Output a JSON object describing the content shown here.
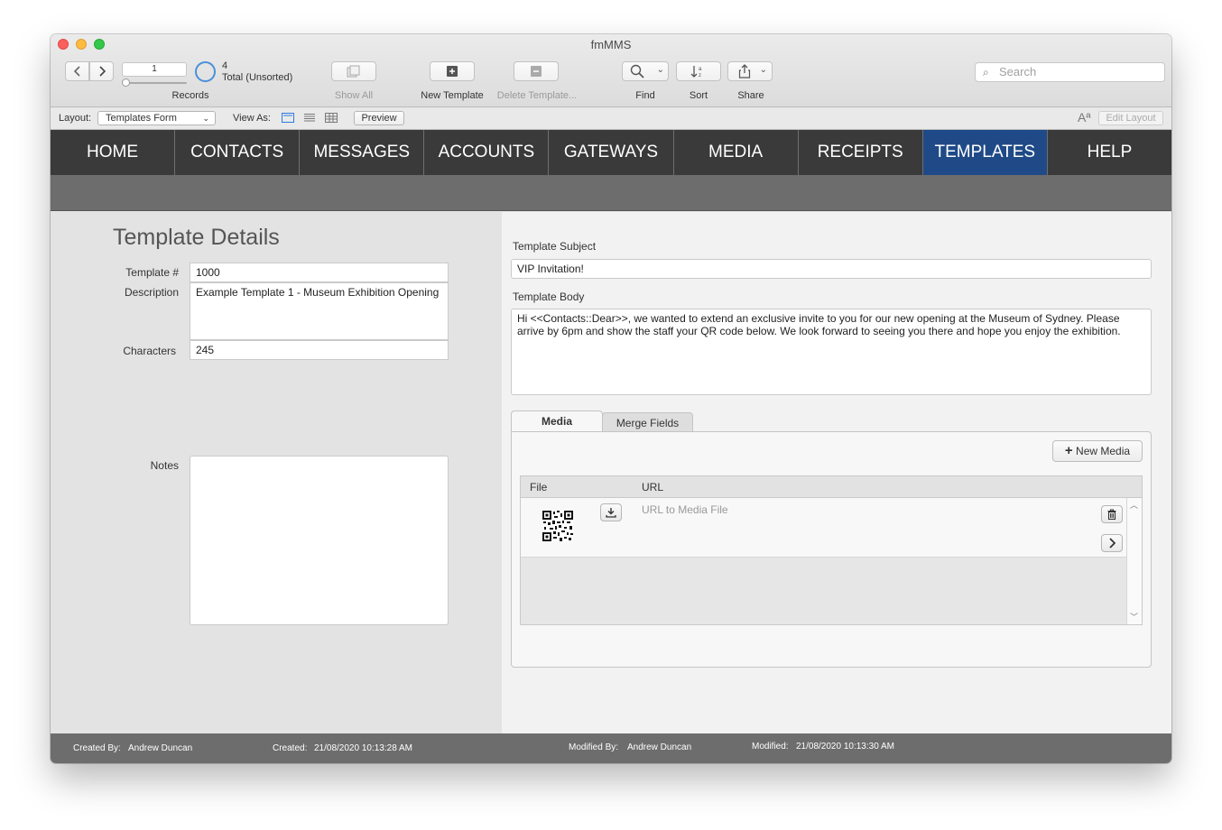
{
  "window": {
    "title": "fmMMS"
  },
  "toolbar": {
    "record_number": "1",
    "record_total": "4",
    "record_status": "Total (Unsorted)",
    "records_label": "Records",
    "show_all_label": "Show All",
    "new_template_label": "New Template",
    "delete_template_label": "Delete Template...",
    "find_label": "Find",
    "sort_label": "Sort",
    "share_label": "Share",
    "search_placeholder": "Search"
  },
  "layout_bar": {
    "layout_label": "Layout:",
    "layout_value": "Templates Form",
    "view_as_label": "View As:",
    "preview_label": "Preview",
    "edit_layout_label": "Edit Layout"
  },
  "nav": {
    "items": [
      {
        "label": "HOME"
      },
      {
        "label": "CONTACTS"
      },
      {
        "label": "MESSAGES"
      },
      {
        "label": "ACCOUNTS"
      },
      {
        "label": "GATEWAYS"
      },
      {
        "label": "MEDIA"
      },
      {
        "label": "RECEIPTS"
      },
      {
        "label": "TEMPLATES"
      },
      {
        "label": "HELP"
      }
    ],
    "active": "TEMPLATES",
    "active_color": "#1f4a87"
  },
  "details": {
    "title": "Template Details",
    "template_no_label": "Template #",
    "template_no": "1000",
    "description_label": "Description",
    "description": "Example Template 1 - Museum Exhibition Opening",
    "characters_label": "Characters",
    "characters": "245",
    "notes_label": "Notes",
    "notes": ""
  },
  "content": {
    "subject_label": "Template Subject",
    "subject": "VIP Invitation!",
    "body_label": "Template Body",
    "body": "Hi <<Contacts::Dear>>, we wanted to extend an exclusive invite to you for our new opening at the Museum of Sydney. Please arrive by 6pm and show the staff your QR code below. We look forward to seeing you there and hope you enjoy the exhibition."
  },
  "media_tabs": {
    "tabs": [
      "Media",
      "Merge Fields"
    ],
    "active": "Media",
    "new_media_label": "New Media",
    "columns": {
      "file": "File",
      "url": "URL"
    },
    "rows": [
      {
        "url_placeholder": "URL to Media File"
      }
    ]
  },
  "footer": {
    "created_by_label": "Created By:",
    "created_by": "Andrew Duncan",
    "created_label": "Created:",
    "created": "21/08/2020 10:13:28 AM",
    "modified_by_label": "Modified By:",
    "modified_by": "Andrew Duncan",
    "modified_label": "Modified:",
    "modified": "21/08/2020 10:13:30 AM"
  }
}
